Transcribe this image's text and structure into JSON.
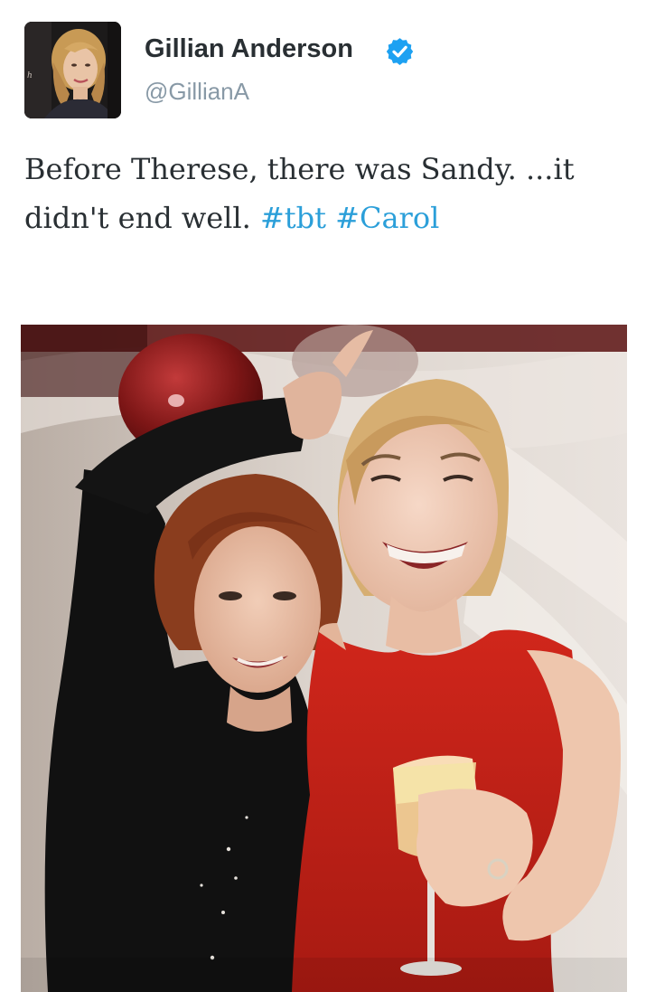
{
  "author": {
    "display_name": "Gillian Anderson",
    "handle": "@GillianA",
    "verified": true,
    "verified_icon": "verified-badge-icon"
  },
  "tweet": {
    "text_1": "Before Therese, there was Sandy. ...it didn't end well. ",
    "hashtag_1": "#tbt",
    "text_2": " ",
    "hashtag_2": "#Carol"
  },
  "media": {
    "type": "photo"
  },
  "colors": {
    "link": "#2b9fd9",
    "text": "#292f33",
    "handle": "#8899a6",
    "verified": "#1da1f2"
  }
}
